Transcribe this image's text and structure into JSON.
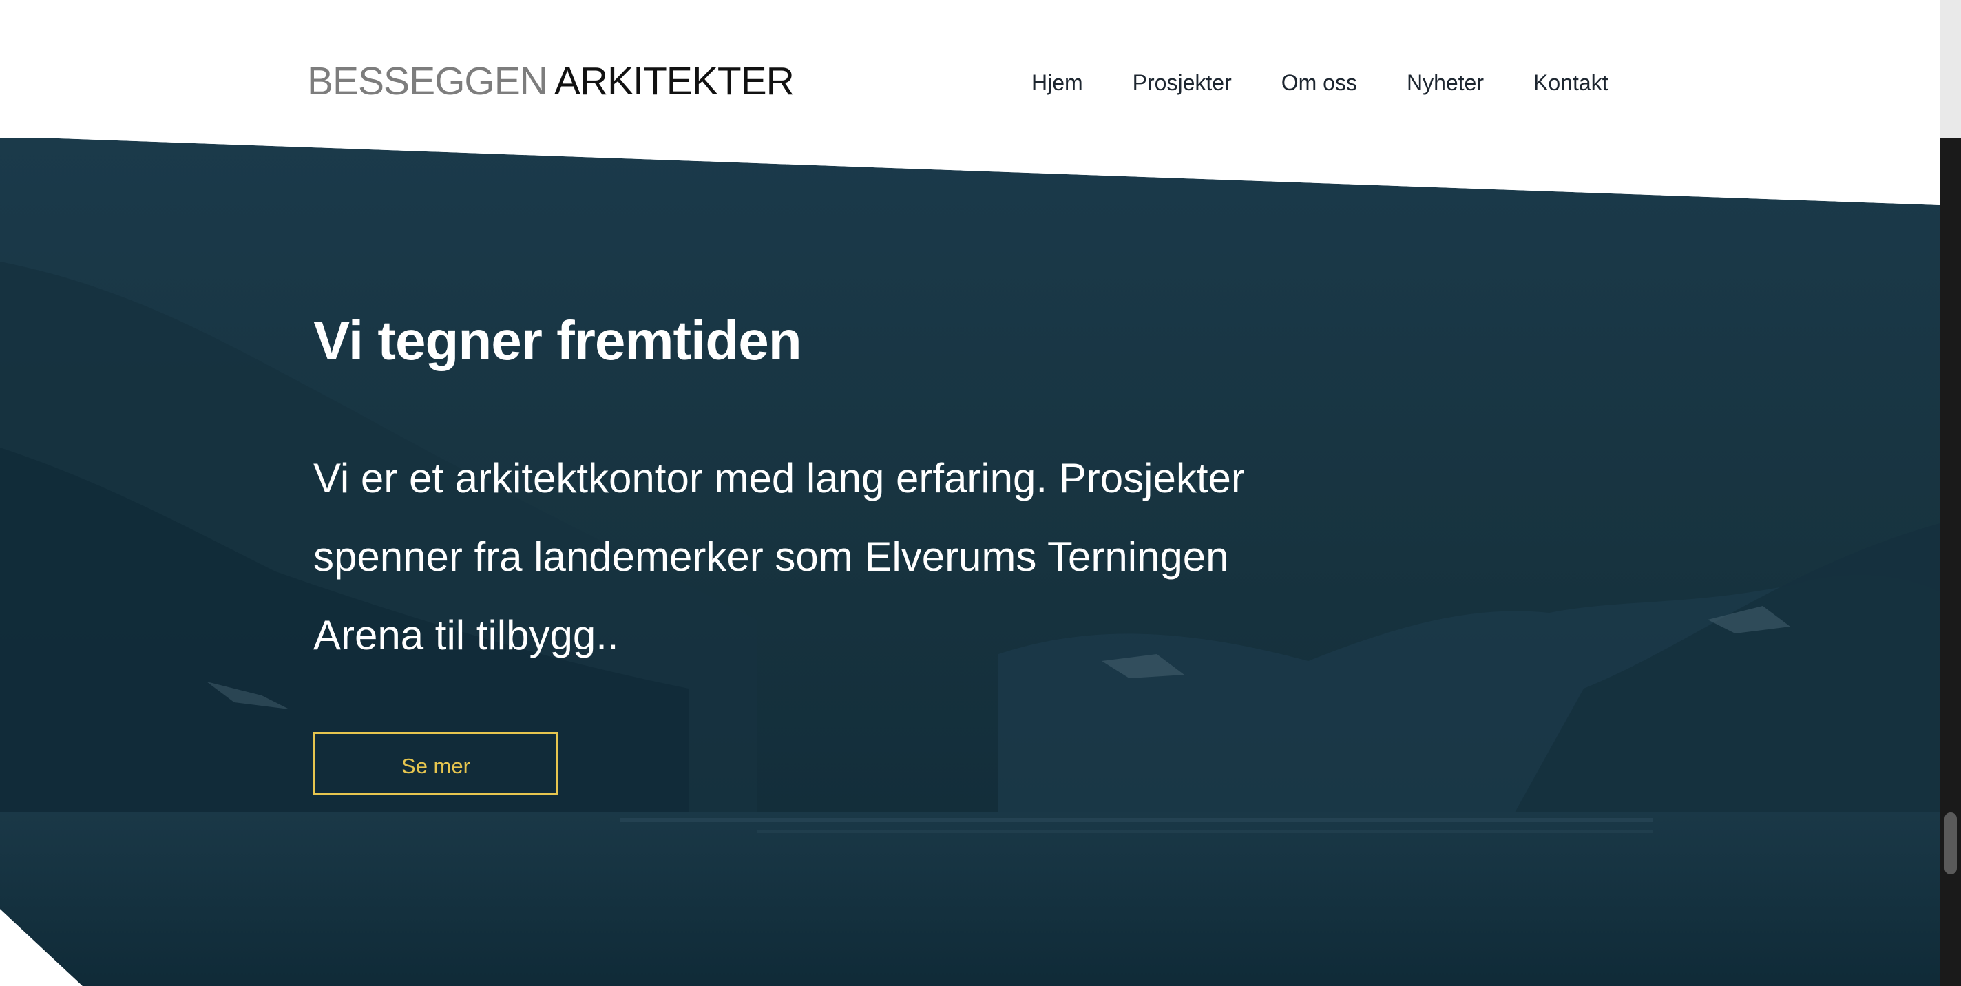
{
  "logo": {
    "part1": "BESSEGGEN",
    "part2": "ARKITEKTER"
  },
  "nav": {
    "items": [
      {
        "label": "Hjem"
      },
      {
        "label": "Prosjekter"
      },
      {
        "label": "Om oss"
      },
      {
        "label": "Nyheter"
      },
      {
        "label": "Kontakt"
      }
    ]
  },
  "hero": {
    "title": "Vi tegner fremtiden",
    "text": "Vi er et arkitektkontor med lang erfaring. Prosjekter spenner fra landemerker som Elverums Terningen Arena til tilbygg..",
    "cta_label": "Se mer"
  },
  "colors": {
    "hero_bg": "#13303f",
    "accent": "#e6c54f",
    "nav_text": "#1d2630"
  }
}
